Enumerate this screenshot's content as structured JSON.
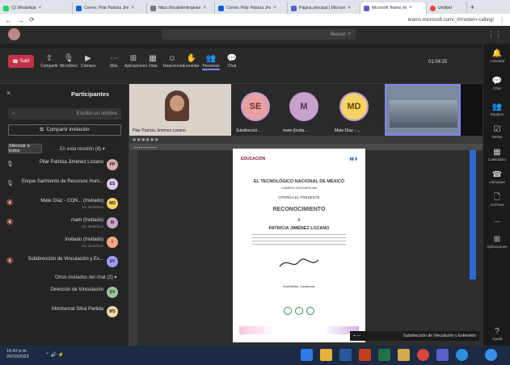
{
  "browser": {
    "tabs": [
      {
        "label": "(1) WhatsApp",
        "color": "#25d366"
      },
      {
        "label": "Correo: Pilar Patricia Jim",
        "color": "#0a64d8"
      },
      {
        "label": "https://localidentingeste",
        "color": "#777777"
      },
      {
        "label": "Correo: Pilar Patricia Jim",
        "color": "#0a64d8"
      },
      {
        "label": "Página principal | Microso",
        "color": "#5b5fc7"
      },
      {
        "label": "Microsoft Teams ón",
        "color": "#5b5fc7"
      },
      {
        "label": "Untitled",
        "color": "#e43"
      }
    ],
    "url": "teams.microsoft.com/_#/modern-calling/"
  },
  "teams": {
    "search_placeholder": "Buscar",
    "meeting_timer": "01:04:25",
    "controls": [
      {
        "label": "Chat",
        "icon": "chat-icon"
      },
      {
        "label": "Personas",
        "icon": "people-icon"
      },
      {
        "label": "Levantar",
        "icon": "hand-icon"
      },
      {
        "label": "Reacciones",
        "icon": "reactions-icon"
      },
      {
        "label": "Vista",
        "icon": "view-icon"
      },
      {
        "label": "Aplicaciones",
        "icon": "apps-icon"
      },
      {
        "label": "Más",
        "icon": "more-icon"
      },
      {
        "label": "Cámara",
        "icon": "camera-icon"
      },
      {
        "label": "Micrófono",
        "icon": "mic-icon"
      },
      {
        "label": "Compartir",
        "icon": "share-icon"
      }
    ],
    "leave_label": "Salir",
    "rail": [
      {
        "label": "Actividad",
        "icon": "bell-icon"
      },
      {
        "label": "Chat",
        "icon": "chat-icon"
      },
      {
        "label": "Equipos",
        "icon": "teams-icon"
      },
      {
        "label": "Tareas",
        "icon": "tasks-icon"
      },
      {
        "label": "Calendario",
        "icon": "calendar-icon"
      },
      {
        "label": "Llamadas",
        "icon": "phone-icon"
      },
      {
        "label": "Archivos",
        "icon": "files-icon"
      },
      {
        "label": "...",
        "icon": "more-icon"
      },
      {
        "label": "Aplicaciones",
        "icon": "apps-icon"
      },
      {
        "label": "Ayuda",
        "icon": "help-icon"
      }
    ]
  },
  "participants": {
    "title": "Participantes",
    "search_placeholder": "Escribir un nombre",
    "share_invite": "Compartir invitación",
    "in_meeting_header": "En esta reunión (8)",
    "mute_all": "Silenciar a todos",
    "people": [
      {
        "name": "Pilar Patricia Jiménez Lozano",
        "sub": "",
        "initials": "PP",
        "color": "#d7a9a9"
      },
      {
        "name": "Enque Sarmiento de Recursos Hum...",
        "sub": "",
        "initials": "ES",
        "color": "#e0c8f0"
      },
      {
        "name": "Mate Díaz - CON... (Invitado)",
        "sub": "Sin identificar",
        "initials": "MD",
        "color": "#f6d365"
      },
      {
        "name": "mam (Invitado)",
        "sub": "Sin identificar",
        "initials": "M",
        "color": "#c8a2c8"
      },
      {
        "name": "Invitado (Invitado)",
        "sub": "Sin identificar",
        "initials": "I",
        "color": "#f3a683"
      },
      {
        "name": "Subdirección de Vinculación y Ex...",
        "sub": "",
        "initials": "SV",
        "color": "#a29bfe"
      }
    ],
    "others_header": "Otros invitados del chat (2)",
    "others": [
      {
        "name": "Dirección de Vinculación",
        "initials": "DV",
        "color": "#9bc59d"
      },
      {
        "name": "Montserrat Silva Partida",
        "initials": "MS",
        "color": "#f3d9a4"
      }
    ]
  },
  "stage": {
    "bubbles": [
      {
        "initials": "MD",
        "color": "#f6d365",
        "label": "Mate Díaz - ..."
      },
      {
        "initials": "M",
        "color": "#c8a2c8",
        "label": "mam (Invita..."
      },
      {
        "initials": "SE",
        "color": "#e8a0a0",
        "label": "Subdirecció..."
      }
    ],
    "presenter_label": "Pilar Patricia Jiménez Lozano",
    "room_label": "",
    "document": {
      "header_left": "EDUCACIÓN",
      "header_right": "TECNOLÓGICO NACIONAL DE MÉXICO",
      "institution": "EL TECNOLÓGICO NACIONAL DE MÉXICO",
      "campus": "CAMPUS NOCHISTLÁN",
      "grants": "OTORGA EL PRESENTE",
      "title": "RECONOCIMIENTO",
      "to": "A",
      "recipient": "PATRICIA JIMÉNEZ LOZANO",
      "place": "Nochistlán, Zacatecas"
    },
    "presenter_bar": "Subdirección de Vinculación y Extensión"
  },
  "taskbar": {
    "time": "10:42 p.m.",
    "date": "20/10/2023"
  }
}
